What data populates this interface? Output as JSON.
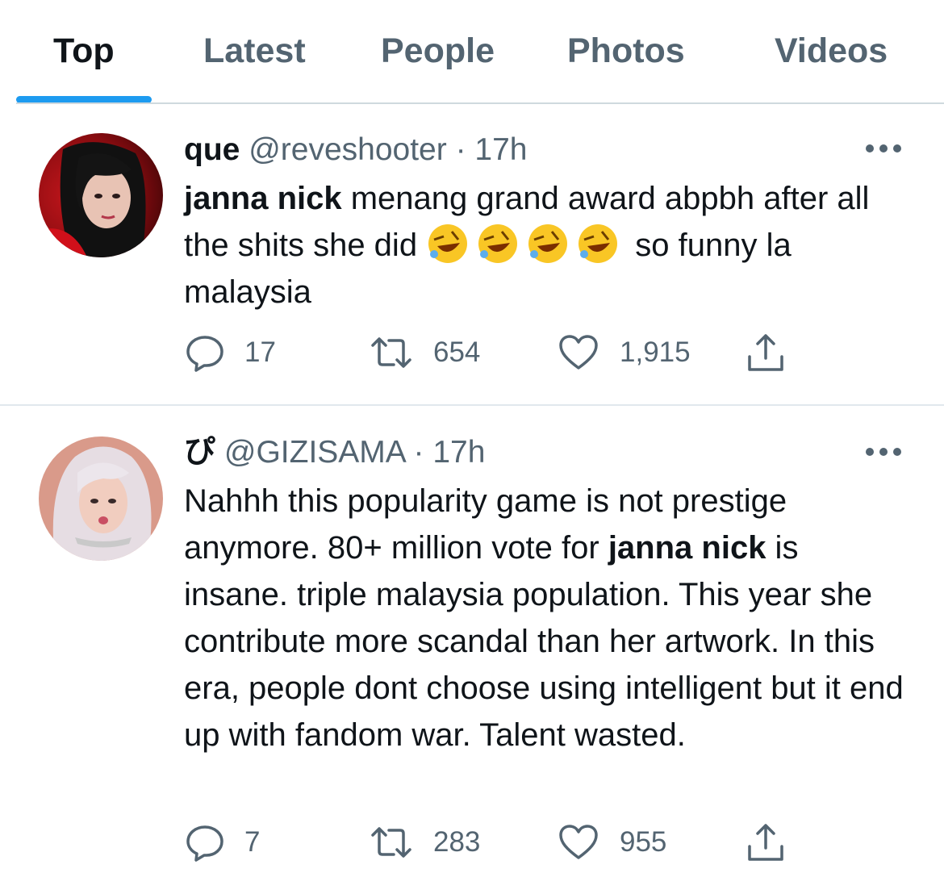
{
  "tabs": [
    {
      "label": "Top",
      "active": true
    },
    {
      "label": "Latest",
      "active": false
    },
    {
      "label": "People",
      "active": false
    },
    {
      "label": "Photos",
      "active": false
    },
    {
      "label": "Videos",
      "active": false
    }
  ],
  "colors": {
    "accent": "#1d9bf0",
    "text": "#0f1419",
    "muted": "#536471"
  },
  "tweets": [
    {
      "display_name": "que",
      "handle": "@reveshooter",
      "separator": "·",
      "time": "17h",
      "body_bold": "janna nick",
      "body_rest1": " menang grand award abpbh after all the shits she did ",
      "emoji": "rolling-on-the-floor-laughing",
      "body_rest2": " so funny la malaysia",
      "replies": "17",
      "retweets": "654",
      "likes": "1,915"
    },
    {
      "display_name": "ぴ",
      "handle": "@GIZISAMA",
      "separator": "·",
      "time": "17h",
      "body_part1": "Nahhh this popularity game is not prestige anymore. 80+ million vote for ",
      "body_bold": "janna nick",
      "body_part2": " is insane. triple malaysia population. This year she contribute more scandal than her artwork. In this era, people dont choose using intelligent but it end up with fandom war. Talent wasted.",
      "replies": "7",
      "retweets": "283",
      "likes": "955"
    }
  ]
}
